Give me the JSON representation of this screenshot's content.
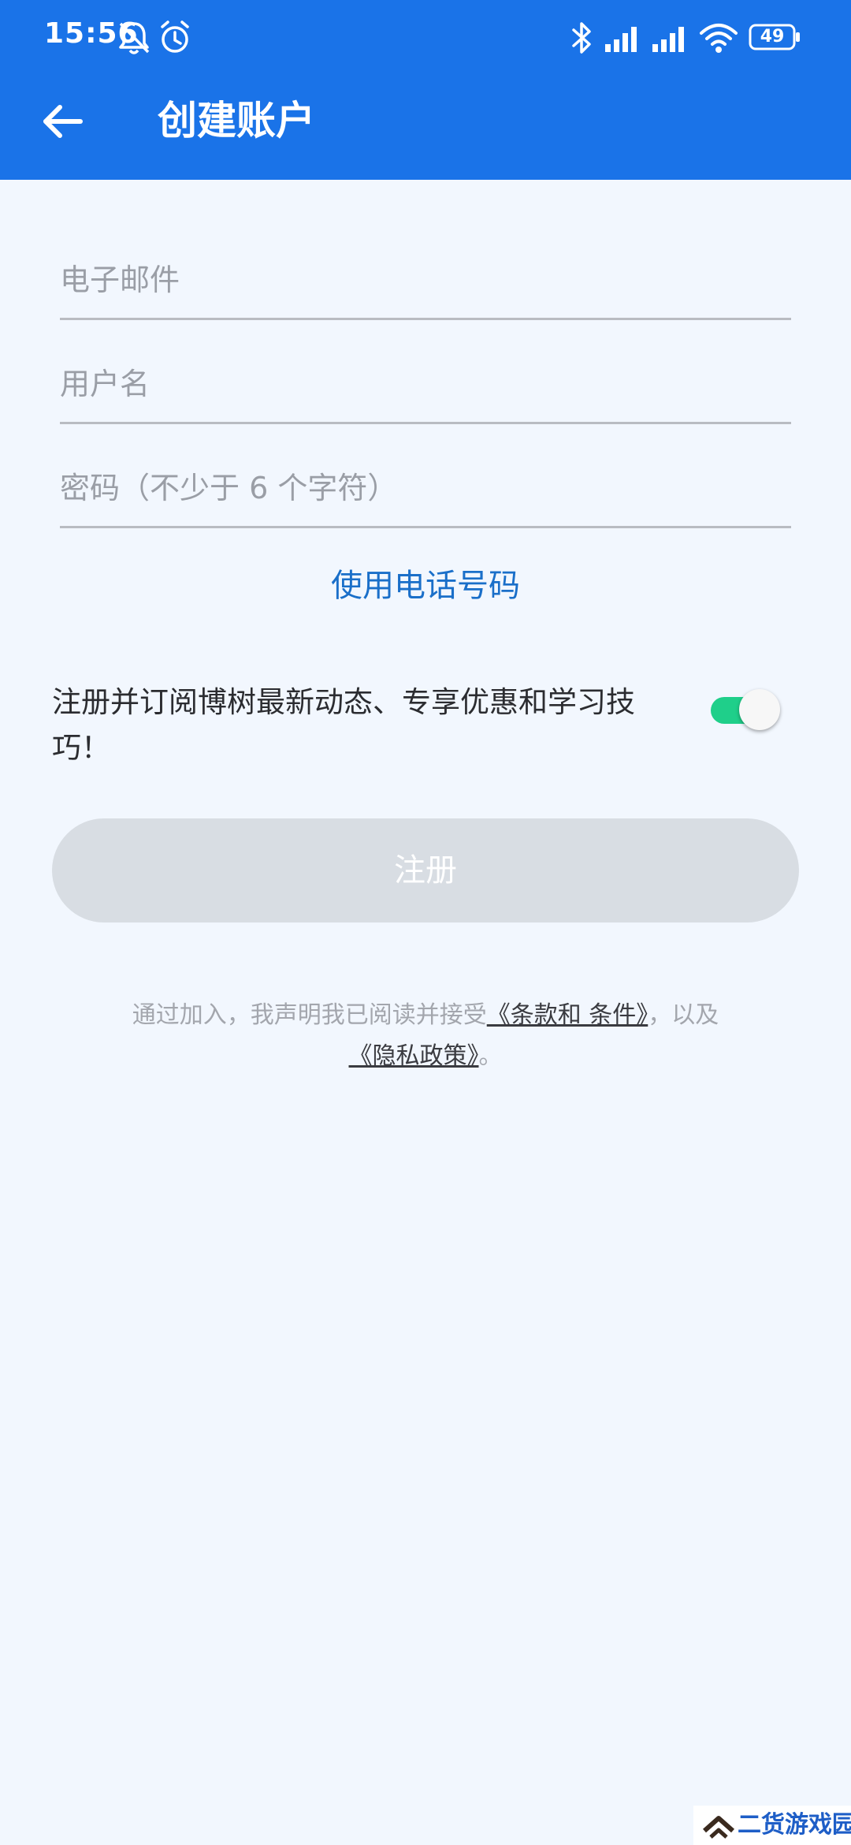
{
  "status_bar": {
    "time": "15:56",
    "battery": "49"
  },
  "header": {
    "title": "创建账户"
  },
  "form": {
    "email_placeholder": "电子邮件",
    "username_placeholder": "用户名",
    "password_placeholder": "密码（不少于 6 个字符）",
    "phone_link": "使用电话号码"
  },
  "subscribe": {
    "label": "注册并订阅博树最新动态、专享优惠和学习技巧！",
    "enabled": true
  },
  "register_button": {
    "label": "注册"
  },
  "legal": {
    "prefix": "通过加入，我声明我已阅读并接受",
    "terms_link": "《条款和 条件》",
    "middle": "，以及",
    "privacy_link": "《隐私政策》",
    "suffix": "。"
  },
  "watermark": {
    "text": "二货游戏园"
  },
  "colors": {
    "app_bar": "#1a73e8",
    "background": "#f2f7fe",
    "link": "#1a6fc9",
    "toggle_on": "#1fcf8a",
    "button_disabled": "#d8dde3"
  }
}
